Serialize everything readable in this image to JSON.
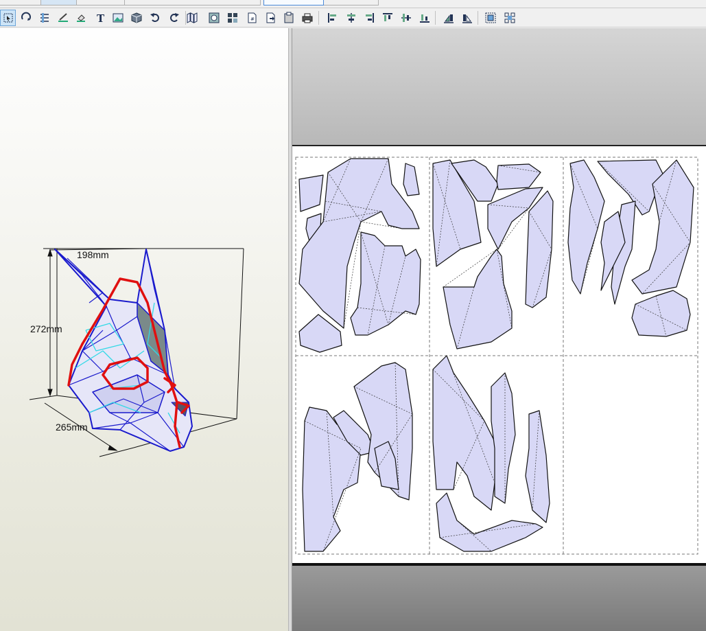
{
  "toolbar": {
    "tools": [
      {
        "name": "select-mode-icon",
        "pressed": true
      },
      {
        "name": "rotate-view-icon"
      },
      {
        "name": "edge-adjust-icon"
      },
      {
        "name": "line-style-icon"
      },
      {
        "name": "paint-icon"
      },
      {
        "name": "text-icon",
        "glyph": "T"
      },
      {
        "name": "image-icon"
      },
      {
        "name": "3d-box-icon"
      },
      {
        "name": "undo-icon"
      },
      {
        "name": "redo-icon"
      },
      {
        "name": "unfold-icon"
      },
      {
        "name": "show-faces-icon"
      },
      {
        "name": "grid-layout-icon"
      },
      {
        "name": "page-number-icon"
      },
      {
        "name": "page-export-icon"
      },
      {
        "name": "clipboard-icon"
      },
      {
        "name": "print-icon"
      },
      {
        "name": "align-left-icon"
      },
      {
        "name": "align-center-h-icon"
      },
      {
        "name": "align-right-icon"
      },
      {
        "name": "align-top-icon"
      },
      {
        "name": "align-center-v-icon"
      },
      {
        "name": "align-bottom-icon"
      },
      {
        "name": "flip-left-icon"
      },
      {
        "name": "flip-right-icon"
      },
      {
        "name": "group-icon"
      },
      {
        "name": "ungroup-icon"
      }
    ]
  },
  "model_view": {
    "width_label": "198mm",
    "height_label": "272mm",
    "depth_label": "265mm",
    "colors": {
      "edge_blue": "#1a1acc",
      "fold_cyan": "#33d9e6",
      "cut_red": "#e01010",
      "face_fill": "#e4e4f8",
      "dark_face": "#7a8a8a"
    }
  },
  "pattern_view": {
    "colors": {
      "part_fill": "#d8d8f6",
      "part_stroke": "#111111",
      "page_border": "#777777"
    },
    "pages_columns": 3,
    "pages_rows": 2
  }
}
